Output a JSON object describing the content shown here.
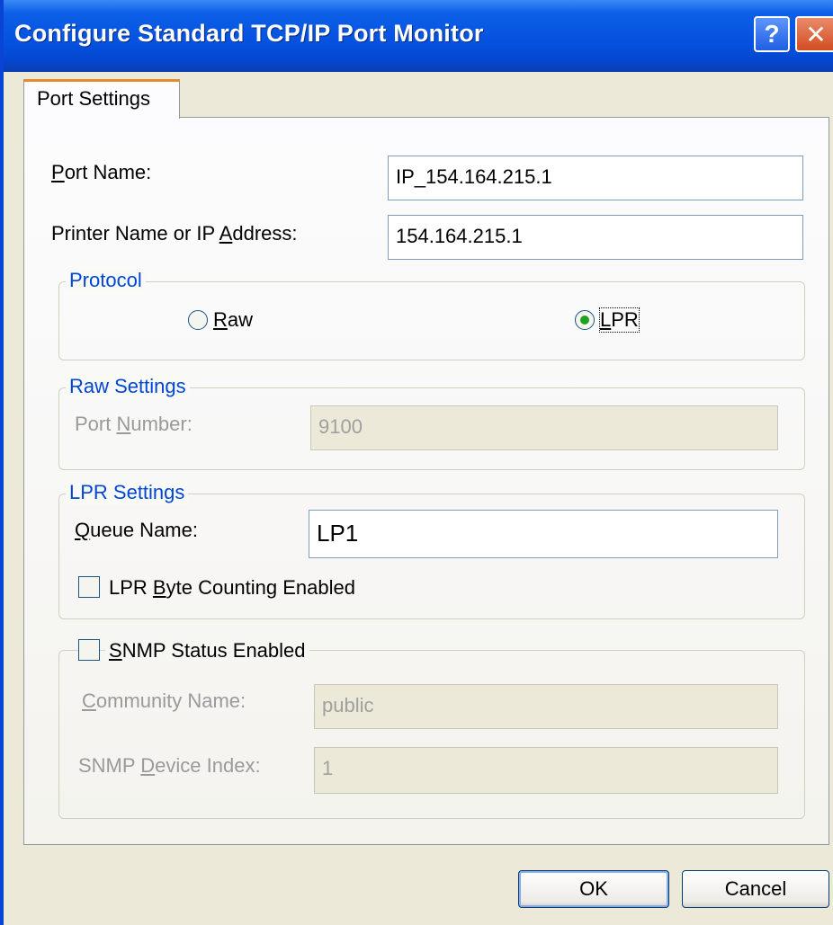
{
  "window": {
    "title": "Configure Standard TCP/IP Port Monitor",
    "help_glyph": "?",
    "close_glyph": "✕"
  },
  "tabs": [
    {
      "label": "Port Settings",
      "active": true
    }
  ],
  "port_name": {
    "label_pre": "",
    "label_key": "P",
    "label_post": "ort Name:",
    "value": "IP_154.164.215.1"
  },
  "printer_address": {
    "label_pre": "Printer Name or IP ",
    "label_key": "A",
    "label_post": "ddress:",
    "value": "154.164.215.1"
  },
  "protocol": {
    "title": "Protocol",
    "raw": {
      "label_key": "R",
      "label_post": "aw",
      "checked": false
    },
    "lpr": {
      "label_key": "L",
      "label_post": "PR",
      "checked": true
    }
  },
  "raw_settings": {
    "title": "Raw Settings",
    "port_number": {
      "label_pre": "Port ",
      "label_key": "N",
      "label_post": "umber:",
      "value": "9100"
    }
  },
  "lpr_settings": {
    "title": "LPR Settings",
    "queue_name": {
      "label_key": "Q",
      "label_post": "ueue Name:",
      "value": "LP1"
    },
    "byte_counting": {
      "label_pre": "LPR ",
      "label_key": "B",
      "label_post": "yte Counting Enabled",
      "checked": false
    }
  },
  "snmp": {
    "enabled": {
      "label_key": "S",
      "label_post": "NMP Status Enabled",
      "checked": false
    },
    "community": {
      "label_key": "C",
      "label_post": "ommunity Name:",
      "value": "public"
    },
    "device_index": {
      "label_pre": "SNMP ",
      "label_key": "D",
      "label_post": "evice Index:",
      "value": "1"
    }
  },
  "buttons": {
    "ok": "OK",
    "cancel": "Cancel"
  },
  "colors": {
    "title_bar": "#0551e0",
    "group_title": "#0046d5",
    "tab_highlight": "#e68b2c"
  }
}
